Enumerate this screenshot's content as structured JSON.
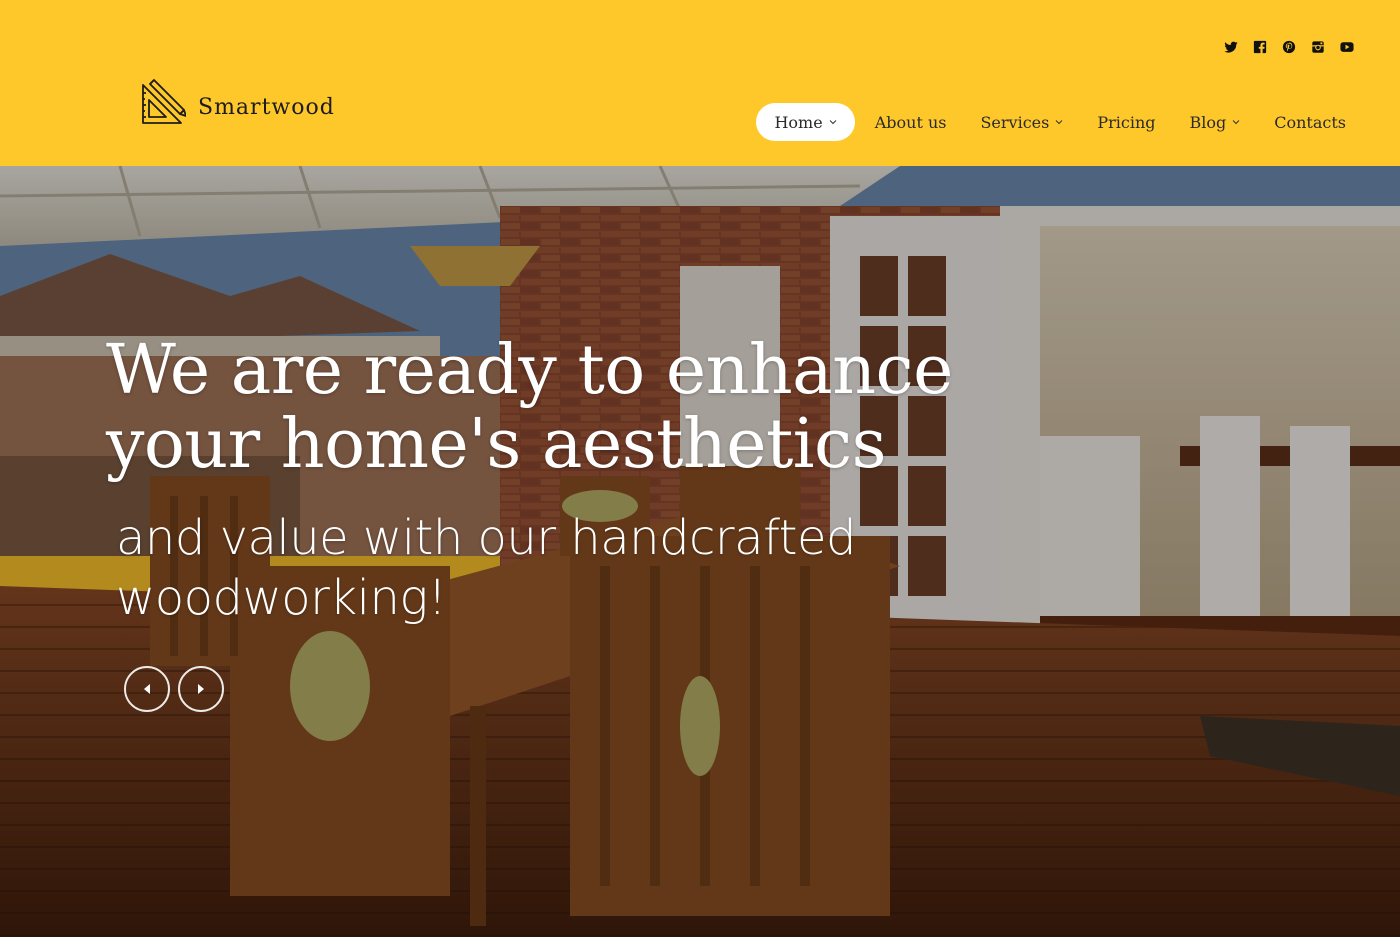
{
  "brand": {
    "name": "Smartwood",
    "logo_icon": "ruler-pencil-icon"
  },
  "social": [
    {
      "name": "twitter",
      "icon": "twitter-icon"
    },
    {
      "name": "facebook",
      "icon": "facebook-icon"
    },
    {
      "name": "pinterest",
      "icon": "pinterest-icon"
    },
    {
      "name": "instagram",
      "icon": "instagram-icon"
    },
    {
      "name": "youtube",
      "icon": "youtube-icon"
    }
  ],
  "nav": {
    "items": [
      {
        "label": "Home",
        "active": true,
        "has_dropdown": true
      },
      {
        "label": "About us",
        "active": false,
        "has_dropdown": false
      },
      {
        "label": "Services",
        "active": false,
        "has_dropdown": true
      },
      {
        "label": "Pricing",
        "active": false,
        "has_dropdown": false
      },
      {
        "label": "Blog",
        "active": false,
        "has_dropdown": true
      },
      {
        "label": "Contacts",
        "active": false,
        "has_dropdown": false
      }
    ]
  },
  "hero": {
    "title": "We are ready to enhance your home's aesthetics",
    "subtitle": "and value with our handcrafted woodworking!",
    "prev_icon": "arrow-left-icon",
    "next_icon": "arrow-right-icon"
  },
  "colors": {
    "accent": "#ffc82a",
    "text_dark": "#2a2a2a",
    "white": "#ffffff"
  }
}
